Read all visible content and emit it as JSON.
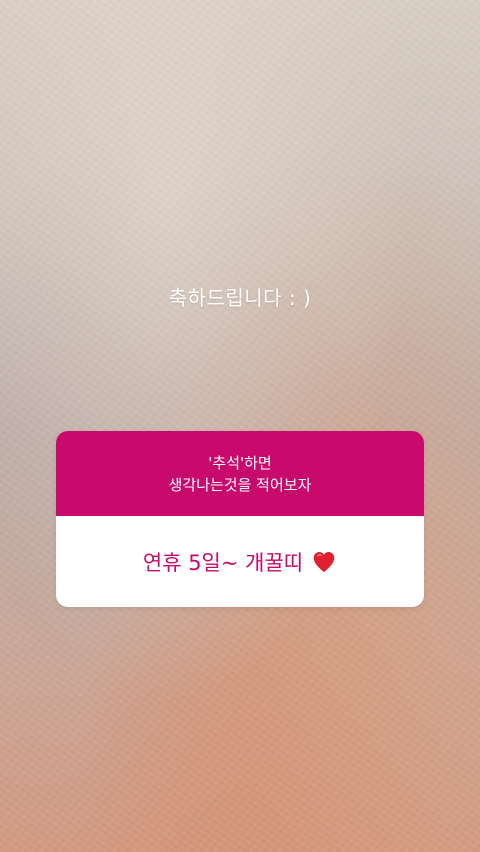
{
  "story": {
    "caption": "축하드립니다 : )"
  },
  "question_sticker": {
    "prompt_line1": "'추석'하면",
    "prompt_line2": "생각나는것을 적어보자",
    "answer": "연휴 5일~ 개꿀띠",
    "answer_emoji_icon": "heart-icon",
    "colors": {
      "header": "#c80a6c",
      "answer_text": "#c80a6c",
      "heart": "#e0202e"
    }
  }
}
